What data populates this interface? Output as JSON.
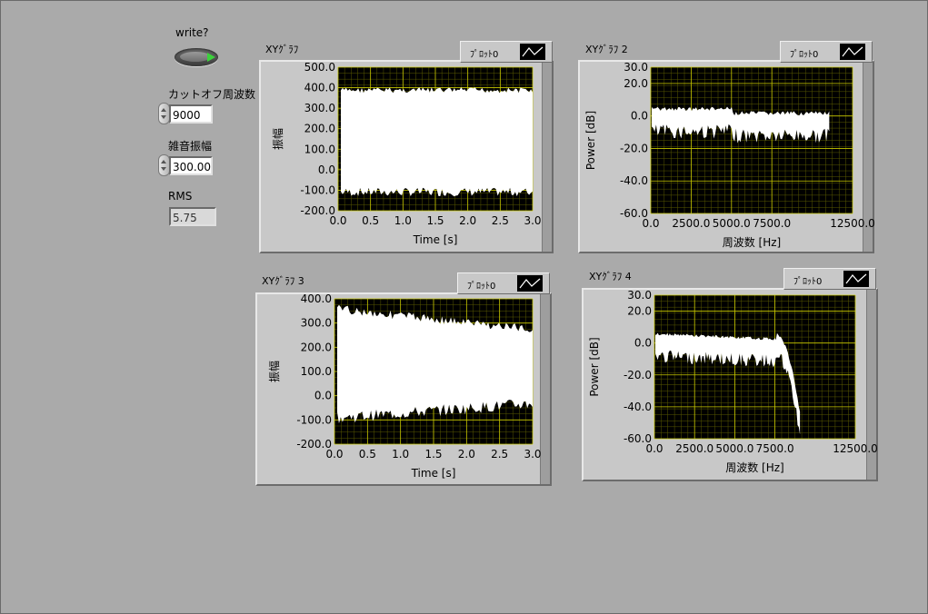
{
  "controls": {
    "write_label": "write?",
    "cutoff_label": "カットオフ周波数",
    "cutoff_value": "9000",
    "noise_label": "雑音振幅",
    "noise_value": "300.00",
    "rms_label": "RMS",
    "rms_value": "5.75"
  },
  "legend_label": "ﾌﾟﾛｯﾄ0",
  "graphs": [
    {
      "title": "XYｸﾞﾗﾌ",
      "xlabel": "Time [s]",
      "ylabel": "振幅",
      "xticks": [
        "0.0",
        "0.5",
        "1.0",
        "1.5",
        "2.0",
        "2.5",
        "3.0"
      ],
      "yticks": [
        "500.0",
        "400.0",
        "300.0",
        "200.0",
        "100.0",
        "0.0",
        "-100.0",
        "-200.0"
      ]
    },
    {
      "title": "XYｸﾞﾗﾌ 2",
      "xlabel": "周波数 [Hz]",
      "ylabel": "Power [dB]",
      "xticks": [
        "0.0",
        "2500.0",
        "5000.0",
        "7500.0",
        "12500.0"
      ],
      "yticks": [
        "30.0",
        "20.0",
        "0.0",
        "-20.0",
        "-40.0",
        "-60.0"
      ]
    },
    {
      "title": "XYｸﾞﾗﾌ 3",
      "xlabel": "Time [s]",
      "ylabel": "振幅",
      "xticks": [
        "0.0",
        "0.5",
        "1.0",
        "1.5",
        "2.0",
        "2.5",
        "3.0"
      ],
      "yticks": [
        "400.0",
        "300.0",
        "200.0",
        "100.0",
        "0.0",
        "-100.0",
        "-200.0"
      ]
    },
    {
      "title": "XYｸﾞﾗﾌ 4",
      "xlabel": "周波数 [Hz]",
      "ylabel": "Power [dB]",
      "xticks": [
        "0.0",
        "2500.0",
        "5000.0",
        "7500.0",
        "12500.0"
      ],
      "yticks": [
        "30.0",
        "20.0",
        "0.0",
        "-20.0",
        "-40.0",
        "-60.0"
      ]
    }
  ],
  "colors": {
    "background": "#aaaaaa",
    "plot_bg": "#000000",
    "grid": "#c8c800",
    "trace": "#ffffff",
    "led_on": "#3cd23c"
  }
}
